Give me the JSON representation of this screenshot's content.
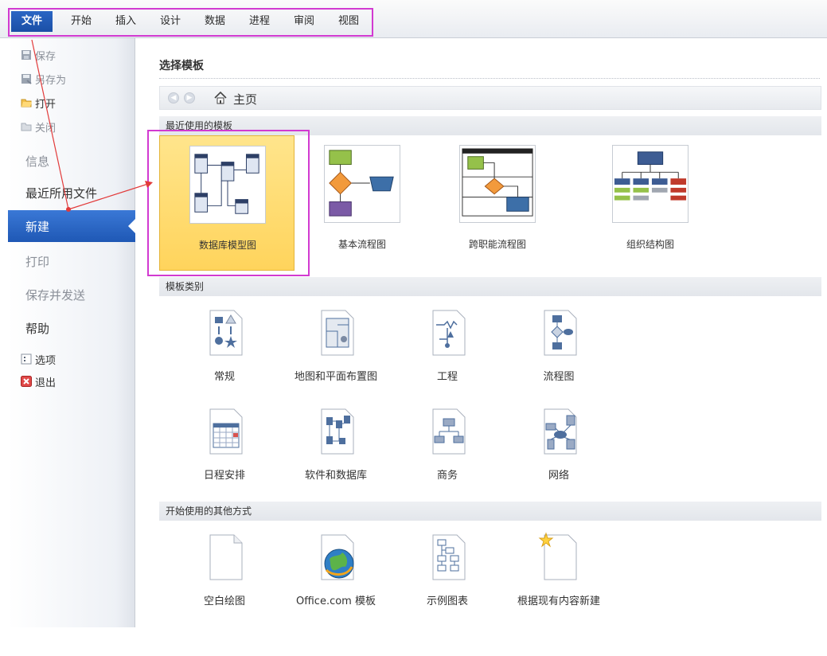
{
  "ribbon": {
    "tabs": [
      "文件",
      "开始",
      "插入",
      "设计",
      "数据",
      "进程",
      "审阅",
      "视图"
    ]
  },
  "backstage": {
    "items": [
      {
        "label": "保存",
        "icon": "save-icon",
        "state": "disabled"
      },
      {
        "label": "另存为",
        "icon": "save-as-icon",
        "state": "disabled"
      },
      {
        "label": "打开",
        "icon": "folder-open-icon",
        "state": "normal"
      },
      {
        "label": "关闭",
        "icon": "close-folder-icon",
        "state": "disabled"
      },
      {
        "label": "信息",
        "state": "disabled"
      },
      {
        "label": "最近所用文件",
        "state": "normal"
      },
      {
        "label": "新建",
        "state": "selected"
      },
      {
        "label": "打印",
        "state": "disabled"
      },
      {
        "label": "保存并发送",
        "state": "disabled"
      },
      {
        "label": "帮助",
        "state": "normal"
      },
      {
        "label": "选项",
        "icon": "options-icon",
        "state": "normal"
      },
      {
        "label": "退出",
        "icon": "exit-icon",
        "state": "normal"
      }
    ]
  },
  "main": {
    "heading": "选择模板",
    "nav_home": "主页",
    "recent_section": "最近使用的模板",
    "recent": [
      {
        "label": "数据库模型图",
        "icon": "database-model-icon",
        "selected": true
      },
      {
        "label": "基本流程图",
        "icon": "basic-flowchart-icon"
      },
      {
        "label": "跨职能流程图",
        "icon": "cross-functional-flowchart-icon"
      },
      {
        "label": "组织结构图",
        "icon": "org-chart-icon"
      }
    ],
    "category_section": "模板类别",
    "categories": [
      {
        "label": "常规",
        "icon": "general-icon"
      },
      {
        "label": "地图和平面布置图",
        "icon": "maps-floorplans-icon"
      },
      {
        "label": "工程",
        "icon": "engineering-icon"
      },
      {
        "label": "流程图",
        "icon": "flowchart-icon"
      },
      {
        "label": "日程安排",
        "icon": "schedule-icon"
      },
      {
        "label": "软件和数据库",
        "icon": "software-database-icon"
      },
      {
        "label": "商务",
        "icon": "business-icon"
      },
      {
        "label": "网络",
        "icon": "network-icon"
      }
    ],
    "other_section": "开始使用的其他方式",
    "other": [
      {
        "label": "空白绘图",
        "icon": "blank-drawing-icon"
      },
      {
        "label": "Office.com 模板",
        "icon": "office-com-globe-icon"
      },
      {
        "label": "示例图表",
        "icon": "sample-diagrams-icon"
      },
      {
        "label": "根据现有内容新建",
        "icon": "new-from-existing-icon"
      }
    ]
  },
  "colors": {
    "file_tab": "#1f58b5",
    "selected_nav": "#2a66c6",
    "selected_card": "#ffd966",
    "highlight_box": "#d23ad1",
    "arrow": "#e23a3a"
  }
}
